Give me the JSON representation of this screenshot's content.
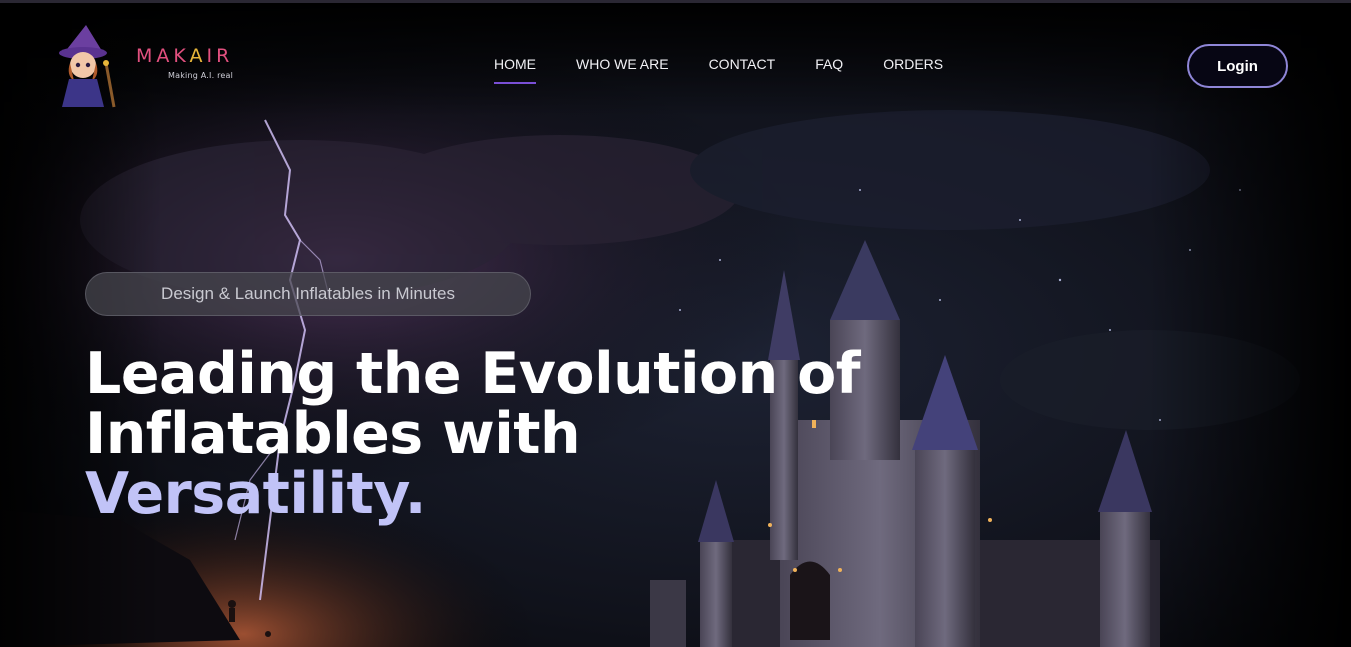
{
  "brand": {
    "name_part1": "MAK",
    "name_part2": "A",
    "name_part3": "IR",
    "tagline": "Making A.I. real"
  },
  "nav": {
    "items": [
      {
        "label": "HOME",
        "active": true
      },
      {
        "label": "WHO WE ARE",
        "active": false
      },
      {
        "label": "CONTACT",
        "active": false
      },
      {
        "label": "FAQ",
        "active": false
      },
      {
        "label": "ORDERS",
        "active": false
      }
    ]
  },
  "header": {
    "login_label": "Login"
  },
  "hero": {
    "badge": "Design & Launch Inflatables in Minutes",
    "headline_line1": "Leading the Evolution of",
    "headline_line2": "Inflatables with",
    "headline_accent": "Versatility."
  },
  "colors": {
    "accent_text": "#c1c3f7",
    "brand_pink": "#e2507f",
    "brand_gold": "#e8b63a",
    "nav_underline": "#7a4fd6",
    "login_border": "#8f86d8"
  }
}
